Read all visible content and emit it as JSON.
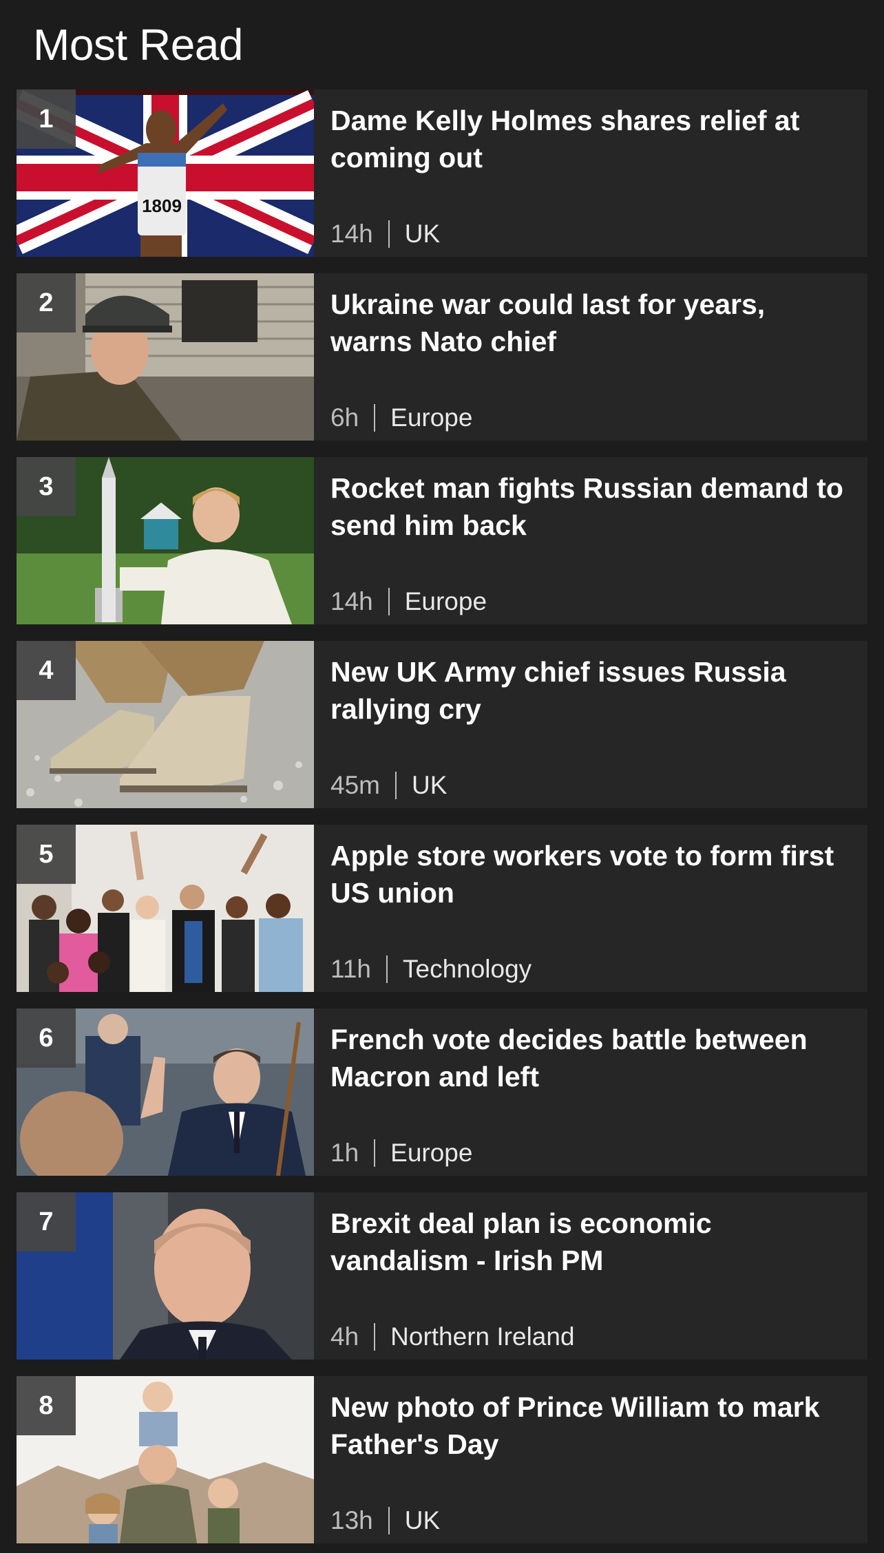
{
  "header": {
    "title": "Most Read"
  },
  "articles": [
    {
      "rank": "1",
      "headline": "Dame Kelly Holmes shares relief at coming out",
      "time": "14h",
      "section": "UK",
      "image": "athlete-with-union-flag"
    },
    {
      "rank": "2",
      "headline": "Ukraine war could last for years, warns Nato chief",
      "time": "6h",
      "section": "Europe",
      "image": "soldier-in-helmet"
    },
    {
      "rank": "3",
      "headline": "Rocket man fights Russian demand to send him back",
      "time": "14h",
      "section": "Europe",
      "image": "man-with-rocket-model"
    },
    {
      "rank": "4",
      "headline": "New UK Army chief issues Russia rallying cry",
      "time": "45m",
      "section": "UK",
      "image": "army-boots-on-gravel"
    },
    {
      "rank": "5",
      "headline": "Apple store workers vote to form first US union",
      "time": "11h",
      "section": "Technology",
      "image": "group-of-workers"
    },
    {
      "rank": "6",
      "headline": "French vote decides battle between Macron and left",
      "time": "1h",
      "section": "Europe",
      "image": "politician-waving"
    },
    {
      "rank": "7",
      "headline": "Brexit deal plan is economic vandalism - Irish PM",
      "time": "4h",
      "section": "Northern Ireland",
      "image": "irish-pm-portrait"
    },
    {
      "rank": "8",
      "headline": "New photo of Prince William to mark Father's Day",
      "time": "13h",
      "section": "UK",
      "image": "family-photo"
    }
  ]
}
